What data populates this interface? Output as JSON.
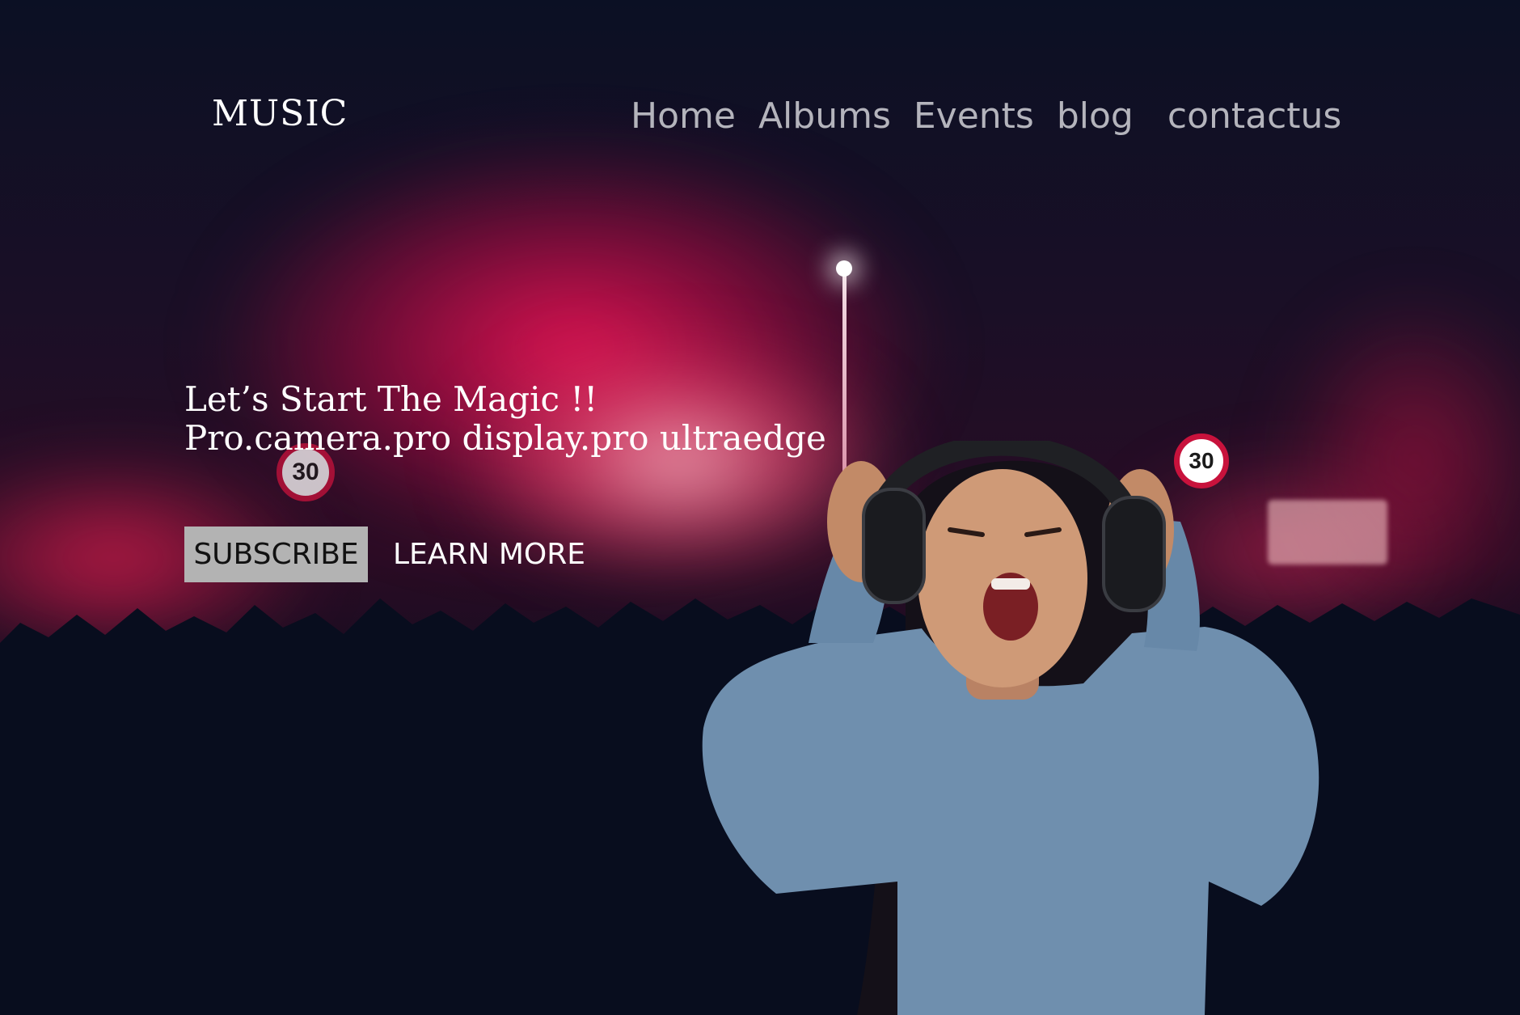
{
  "nav": {
    "logo": "MUSIC",
    "links": [
      "Home",
      "Albums",
      "Events",
      "blog",
      "contactus"
    ]
  },
  "hero": {
    "headline": "Let’s Start The Magic !!",
    "subline": "Pro.camera.pro display.pro ultraedge",
    "subscribe_label": "SUBSCRIBE",
    "learn_more_label": "LEARN MORE"
  },
  "background": {
    "signs": [
      "30",
      "30"
    ]
  },
  "colors": {
    "page_background": "#060b1c",
    "haze_accent": "#eb1455",
    "nav_text": "#b4b4bc",
    "hero_text": "#ffffff",
    "subscribe_button": "#b3b3b3"
  }
}
